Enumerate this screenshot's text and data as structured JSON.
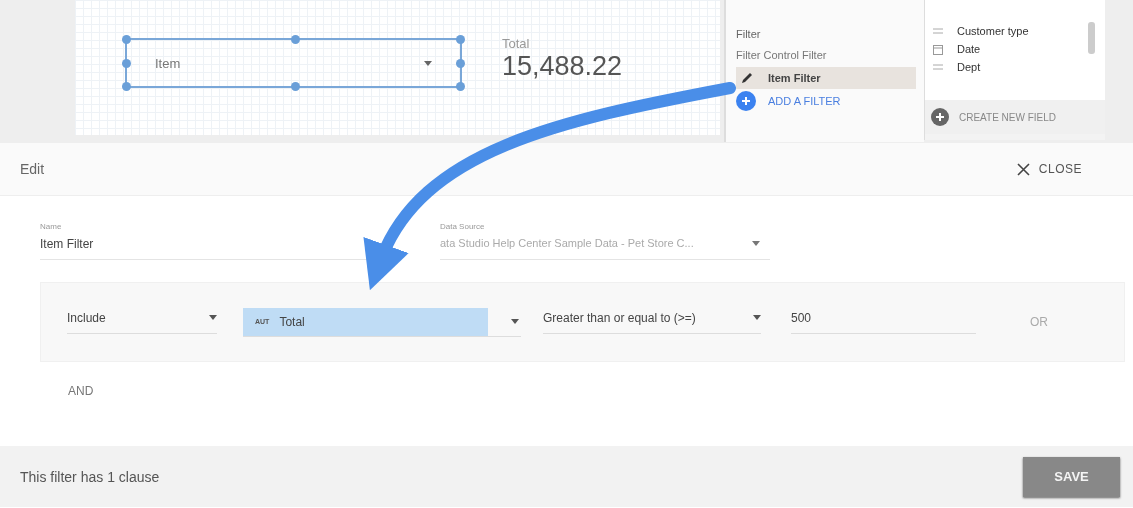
{
  "canvas": {
    "control": {
      "label": "Item"
    },
    "scorecard": {
      "label": "Total",
      "value": "15,488.22"
    }
  },
  "filter_panel": {
    "title": "Filter",
    "subtitle": "Filter Control Filter",
    "items": [
      {
        "label": "Item Filter",
        "selected": true
      }
    ],
    "add_label": "ADD A FILTER"
  },
  "fields_panel": {
    "fields": [
      {
        "kind": "text",
        "label": "Customer type"
      },
      {
        "kind": "date",
        "label": "Date"
      },
      {
        "kind": "text",
        "label": "Dept"
      }
    ],
    "create_label": "CREATE NEW FIELD"
  },
  "edit_bar": {
    "title": "Edit",
    "close_label": "CLOSE"
  },
  "form": {
    "name_label": "Name",
    "name_value": "Item Filter",
    "source_label": "Data Source",
    "source_value": "ata Studio Help Center Sample Data - Pet Store C..."
  },
  "clause": {
    "mode": "Include",
    "field_badge": "AUT",
    "field": "Total",
    "operator": "Greater than or equal to (>=)",
    "value": "500",
    "or_label": "OR"
  },
  "and_label": "AND",
  "footer": {
    "summary": "This filter has 1 clause",
    "save_label": "SAVE"
  }
}
